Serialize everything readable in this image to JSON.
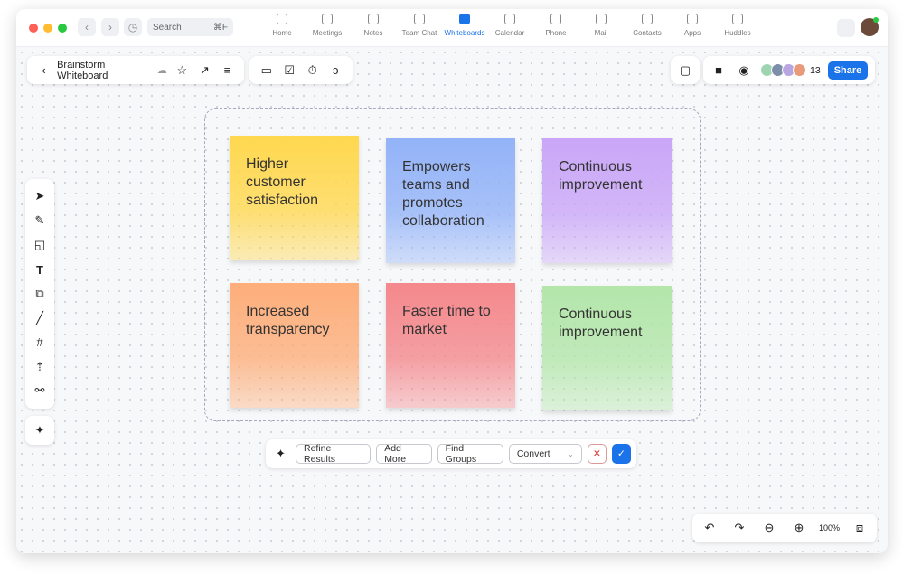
{
  "titlebar": {
    "search_placeholder": "Search",
    "search_shortcut": "⌘F"
  },
  "nav": [
    {
      "label": "Home",
      "icon": "home-icon"
    },
    {
      "label": "Meetings",
      "icon": "video-icon"
    },
    {
      "label": "Notes",
      "icon": "notes-icon"
    },
    {
      "label": "Team Chat",
      "icon": "chat-icon"
    },
    {
      "label": "Whiteboards",
      "icon": "whiteboard-icon",
      "active": true
    },
    {
      "label": "Calendar",
      "icon": "calendar-icon"
    },
    {
      "label": "Phone",
      "icon": "phone-icon"
    },
    {
      "label": "Mail",
      "icon": "mail-icon"
    },
    {
      "label": "Contacts",
      "icon": "contacts-icon"
    },
    {
      "label": "Apps",
      "icon": "apps-icon"
    },
    {
      "label": "Huddles",
      "icon": "huddles-icon"
    }
  ],
  "board": {
    "title": "Brainstorm Whiteboard",
    "participant_count": "13",
    "share_label": "Share"
  },
  "notes": [
    {
      "text": "Higher customer satisfaction",
      "color": "#ffd84f"
    },
    {
      "text": "Empowers teams and promotes collaboration",
      "color": "#93b3f8"
    },
    {
      "text": "Continuous improvement",
      "color": "#c9a6f7"
    },
    {
      "text": "Increased transparency",
      "color": "#fdae7a"
    },
    {
      "text": "Faster time to market",
      "color": "#f4888c"
    },
    {
      "text": "Continuous improvement",
      "color": "#b3e6aa"
    }
  ],
  "ai_bar": {
    "refine": "Refine Results",
    "add_more": "Add More",
    "find_groups": "Find Groups",
    "convert": "Convert"
  },
  "zoom": {
    "level": "100%"
  },
  "colors": {
    "accent": "#1a73e8"
  }
}
